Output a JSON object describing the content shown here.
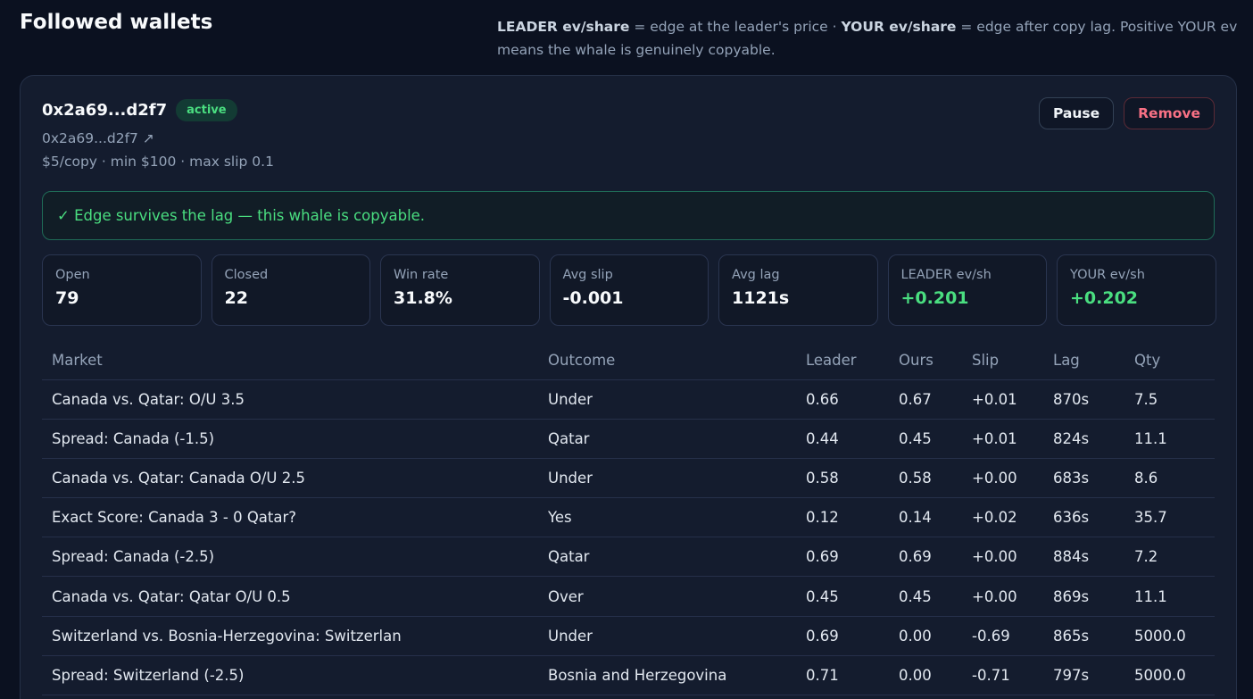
{
  "header": {
    "title": "Followed wallets",
    "legend": {
      "leader_term": "LEADER ev/share",
      "leader_desc": " = edge at the leader's price · ",
      "your_term": "YOUR ev/share",
      "your_desc": " = edge after copy lag. Positive YOUR ev means the whale is genuinely copyable."
    }
  },
  "wallet": {
    "name": "0x2a69...d2f7",
    "status": "active",
    "link_text": "0x2a69...d2f7 ↗",
    "config": "$5/copy · min $100 · max slip 0.1",
    "pause_label": "Pause",
    "remove_label": "Remove",
    "edge_message": "✓ Edge survives the lag — this whale is copyable."
  },
  "stats": [
    {
      "label": "Open",
      "value": "79"
    },
    {
      "label": "Closed",
      "value": "22"
    },
    {
      "label": "Win rate",
      "value": "31.8%"
    },
    {
      "label": "Avg slip",
      "value": "-0.001"
    },
    {
      "label": "Avg lag",
      "value": "1121s"
    },
    {
      "label": "LEADER ev/sh",
      "value": "+0.201"
    },
    {
      "label": "YOUR ev/sh",
      "value": "+0.202"
    }
  ],
  "table": {
    "headers": [
      "Market",
      "Outcome",
      "Leader",
      "Ours",
      "Slip",
      "Lag",
      "Qty"
    ],
    "rows": [
      [
        "Canada vs. Qatar: O/U 3.5",
        "Under",
        "0.66",
        "0.67",
        "+0.01",
        "870s",
        "7.5"
      ],
      [
        "Spread: Canada (-1.5)",
        "Qatar",
        "0.44",
        "0.45",
        "+0.01",
        "824s",
        "11.1"
      ],
      [
        "Canada vs. Qatar: Canada O/U 2.5",
        "Under",
        "0.58",
        "0.58",
        "+0.00",
        "683s",
        "8.6"
      ],
      [
        "Exact Score: Canada 3 - 0 Qatar?",
        "Yes",
        "0.12",
        "0.14",
        "+0.02",
        "636s",
        "35.7"
      ],
      [
        "Spread: Canada (-2.5)",
        "Qatar",
        "0.69",
        "0.69",
        "+0.00",
        "884s",
        "7.2"
      ],
      [
        "Canada vs. Qatar: Qatar O/U 0.5",
        "Over",
        "0.45",
        "0.45",
        "+0.00",
        "869s",
        "11.1"
      ],
      [
        "Switzerland vs. Bosnia-Herzegovina: Switzerlan",
        "Under",
        "0.69",
        "0.00",
        "-0.69",
        "865s",
        "5000.0"
      ],
      [
        "Spread: Switzerland (-2.5)",
        "Bosnia and Herzegovina",
        "0.71",
        "0.00",
        "-0.71",
        "797s",
        "5000.0"
      ]
    ]
  }
}
